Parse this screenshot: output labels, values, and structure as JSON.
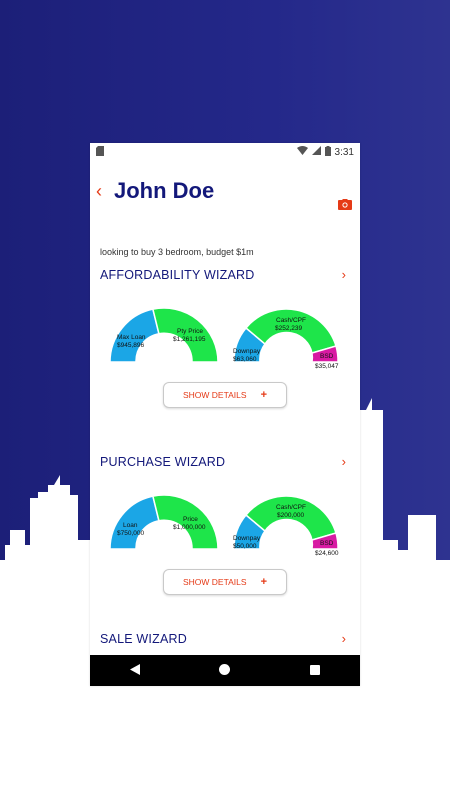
{
  "status": {
    "time": "3:31"
  },
  "header": {
    "back_icon": "chevron-left-icon",
    "name": "John Doe",
    "camera_icon": "camera-icon"
  },
  "description": "looking to buy 3 bedroom, budget $1m",
  "colors": {
    "accent": "#e53a17",
    "navy": "#13187a",
    "blue": "#1ba6e6",
    "green": "#1ee54a",
    "magenta": "#d81aa3"
  },
  "sections": [
    {
      "title": "AFFORDABILITY WIZARD",
      "left_gauge": {
        "a_label": "Max Loan",
        "a_value": "$945,896",
        "b_label": "Pty Price",
        "b_value": "$1,261,195"
      },
      "right_gauge": {
        "a_label": "Downpay",
        "a_value": "$63,060",
        "b_label": "Cash/CPF",
        "b_value": "$252,239",
        "c_label": "BSD",
        "c_value": "$35,047"
      },
      "button": "SHOW DETAILS"
    },
    {
      "title": "PURCHASE WIZARD",
      "left_gauge": {
        "a_label": "Loan",
        "a_value": "$750,000",
        "b_label": "Price",
        "b_value": "$1,000,000"
      },
      "right_gauge": {
        "a_label": "Downpay",
        "a_value": "$50,000",
        "b_label": "Cash/CPF",
        "b_value": "$200,000",
        "c_label": "BSD",
        "c_value": "$24,600"
      },
      "button": "SHOW DETAILS"
    },
    {
      "title": "SALE WIZARD"
    }
  ]
}
